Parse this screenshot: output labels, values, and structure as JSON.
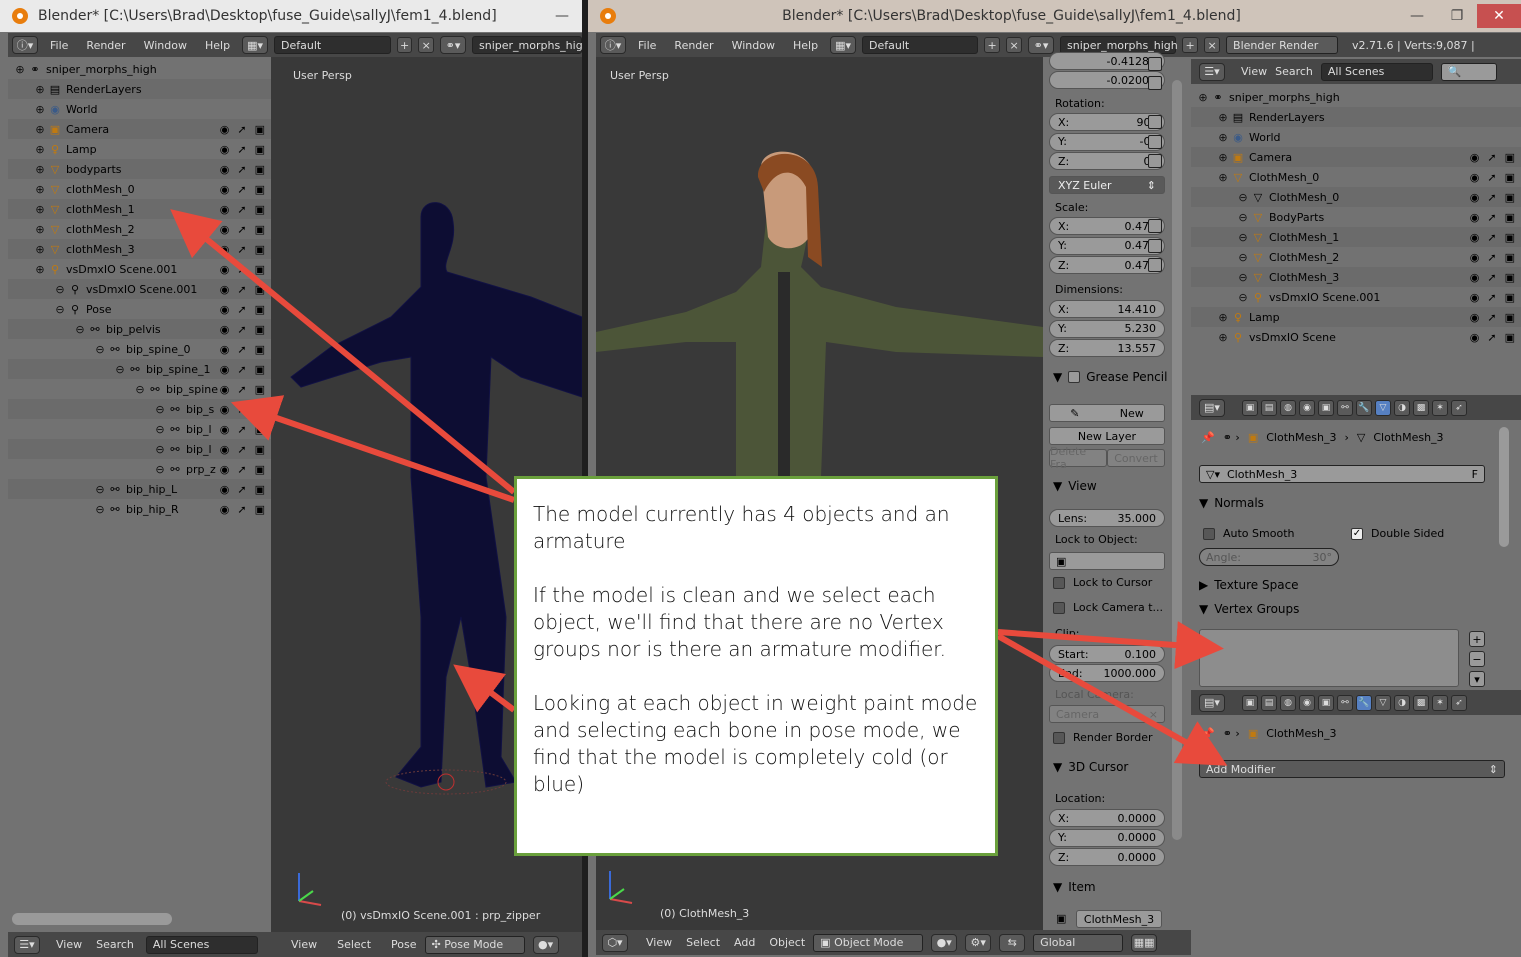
{
  "left_window": {
    "title": "Blender* [C:\\Users\\Brad\\Desktop\\fuse_Guide\\sallyJ\\fem1_4.blend]",
    "menus": [
      "File",
      "Render",
      "Window",
      "Help"
    ],
    "layout": "Default",
    "scene": "sniper_morphs_high",
    "outliner": [
      {
        "label": "sniper_morphs_high",
        "depth": 0,
        "icon": "scene-icon"
      },
      {
        "label": "RenderLayers",
        "depth": 1,
        "icon": "renderlayers-icon"
      },
      {
        "label": "World",
        "depth": 1,
        "icon": "world-icon"
      },
      {
        "label": "Camera",
        "depth": 1,
        "icon": "camera-icon"
      },
      {
        "label": "Lamp",
        "depth": 1,
        "icon": "lamp-icon"
      },
      {
        "label": "bodyparts",
        "depth": 1,
        "icon": "mesh-icon"
      },
      {
        "label": "clothMesh_0",
        "depth": 1,
        "icon": "mesh-icon"
      },
      {
        "label": "clothMesh_1",
        "depth": 1,
        "icon": "mesh-icon"
      },
      {
        "label": "clothMesh_2",
        "depth": 1,
        "icon": "mesh-icon"
      },
      {
        "label": "clothMesh_3",
        "depth": 1,
        "icon": "mesh-icon"
      },
      {
        "label": "vsDmxIO Scene.001",
        "depth": 1,
        "icon": "armature-icon"
      },
      {
        "label": "vsDmxIO Scene.001",
        "depth": 2,
        "icon": "armature-data-icon"
      },
      {
        "label": "Pose",
        "depth": 2,
        "icon": "pose-icon"
      },
      {
        "label": "bip_pelvis",
        "depth": 3,
        "icon": "bone-icon"
      },
      {
        "label": "bip_spine_0",
        "depth": 4,
        "icon": "bone-icon"
      },
      {
        "label": "bip_spine_1",
        "depth": 5,
        "icon": "bone-icon"
      },
      {
        "label": "bip_spine",
        "depth": 6,
        "icon": "bone-icon"
      },
      {
        "label": "bip_s",
        "depth": 7,
        "icon": "bone-icon"
      },
      {
        "label": "bip_l",
        "depth": 7,
        "icon": "bone-icon"
      },
      {
        "label": "bip_l",
        "depth": 7,
        "icon": "bone-icon"
      },
      {
        "label": "prp_z",
        "depth": 7,
        "icon": "bone-icon"
      },
      {
        "label": "bip_hip_L",
        "depth": 4,
        "icon": "bone-icon"
      },
      {
        "label": "bip_hip_R",
        "depth": 4,
        "icon": "bone-icon"
      }
    ],
    "footer": {
      "view": "View",
      "search": "Search",
      "scenes": "All Scenes"
    },
    "viewport": {
      "label": "User Persp",
      "status": "(0) vsDmxIO Scene.001 : prp_zipper",
      "menus": [
        "View",
        "Select",
        "Pose"
      ],
      "mode": "Pose Mode"
    }
  },
  "right_window": {
    "title": "Blender* [C:\\Users\\Brad\\Desktop\\fuse_Guide\\sallyJ\\fem1_4.blend]",
    "menus": [
      "File",
      "Render",
      "Window",
      "Help"
    ],
    "layout": "Default",
    "scene": "sniper_morphs_high",
    "engine": "Blender Render",
    "version": "v2.71.6 | Verts:9,087 |",
    "viewport": {
      "label": "User Persp",
      "status": "(0) ClothMesh_3",
      "menus": [
        "View",
        "Select",
        "Add",
        "Object"
      ],
      "mode": "Object Mode",
      "orientation": "Global"
    },
    "npanel": {
      "loc_y": "-0.41283",
      "loc_z": "-0.02004",
      "rotation_label": "Rotation:",
      "rot": [
        [
          "X:",
          "90°"
        ],
        [
          "Y:",
          "-0°"
        ],
        [
          "Z:",
          "0°"
        ]
      ],
      "euler": "XYZ Euler",
      "scale_label": "Scale:",
      "scale": [
        [
          "X:",
          "0.475"
        ],
        [
          "Y:",
          "0.475"
        ],
        [
          "Z:",
          "0.475"
        ]
      ],
      "dim_label": "Dimensions:",
      "dim": [
        [
          "X:",
          "14.410"
        ],
        [
          "Y:",
          "5.230"
        ],
        [
          "Z:",
          "13.557"
        ]
      ],
      "grease": "Grease Pencil",
      "new": "New",
      "new_layer": "New Layer",
      "delete_frame": "Delete Fra",
      "convert": "Convert",
      "view": "View",
      "lens_label": "Lens:",
      "lens": "35.000",
      "lock_obj": "Lock to Object:",
      "lock_cursor": "Lock to Cursor",
      "lock_camera": "Lock Camera t...",
      "clip": "Clip:",
      "start_label": "Start:",
      "start": "0.100",
      "end_label": "End:",
      "end": "1000.000",
      "local_camera": "Local Camera:",
      "camera": "Camera",
      "render_border": "Render Border",
      "cursor3d": "3D Cursor",
      "location": "Location:",
      "cur": [
        [
          "X:",
          "0.0000"
        ],
        [
          "Y:",
          "0.0000"
        ],
        [
          "Z:",
          "0.0000"
        ]
      ],
      "item": "Item",
      "item_name": "ClothMesh_3"
    },
    "outliner_hdr": {
      "view": "View",
      "search": "Search",
      "scenes": "All Scenes"
    },
    "outliner": [
      {
        "label": "sniper_morphs_high",
        "depth": 0,
        "icon": "scene-icon"
      },
      {
        "label": "RenderLayers",
        "depth": 1,
        "icon": "renderlayers-icon"
      },
      {
        "label": "World",
        "depth": 1,
        "icon": "world-icon"
      },
      {
        "label": "Camera",
        "depth": 1,
        "icon": "camera-icon"
      },
      {
        "label": "ClothMesh_0",
        "depth": 1,
        "icon": "mesh-icon"
      },
      {
        "label": "ClothMesh_0",
        "depth": 2,
        "icon": "mesh-data-icon"
      },
      {
        "label": "BodyParts",
        "depth": 2,
        "icon": "mesh-icon"
      },
      {
        "label": "ClothMesh_1",
        "depth": 2,
        "icon": "mesh-icon"
      },
      {
        "label": "ClothMesh_2",
        "depth": 2,
        "icon": "mesh-icon"
      },
      {
        "label": "ClothMesh_3",
        "depth": 2,
        "icon": "mesh-icon"
      },
      {
        "label": "vsDmxIO Scene.001",
        "depth": 2,
        "icon": "armature-icon"
      },
      {
        "label": "Lamp",
        "depth": 1,
        "icon": "lamp-icon"
      },
      {
        "label": "vsDmxIO Scene",
        "depth": 1,
        "icon": "armature-icon"
      }
    ],
    "props": {
      "crumb1": "ClothMesh_3",
      "crumb2": "ClothMesh_3",
      "mesh_name": "ClothMesh_3",
      "fake": "F",
      "normals": "Normals",
      "auto_smooth": "Auto Smooth",
      "double_sided": "Double Sided",
      "angle_label": "Angle:",
      "angle": "30°",
      "texture_space": "Texture Space",
      "vertex_groups": "Vertex Groups"
    },
    "mods": {
      "crumb": "ClothMesh_3",
      "add_modifier": "Add Modifier"
    }
  },
  "note": {
    "p1": "The model currently has 4 objects and an armature",
    "p2": "If the model is clean and we select each object, we'll find that there are no Vertex groups nor is there an armature modifier.",
    "p3": "Looking at each object in weight paint mode and selecting each bone in pose mode, we find that the model is completely cold (or blue)"
  },
  "colors": {
    "annotation_arrow": "#e84a3c",
    "annotation_border": "#6aa03c",
    "active_tab": "#5680c2"
  }
}
